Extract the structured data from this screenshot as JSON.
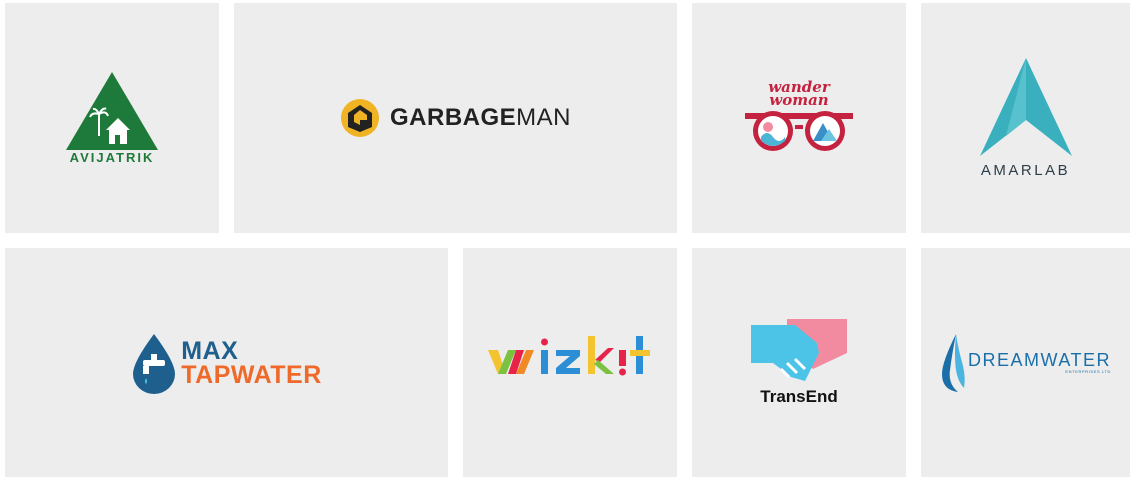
{
  "logos": [
    {
      "name": "AVIJATRIK",
      "colors": {
        "primary": "#1d7a3a"
      }
    },
    {
      "name_bold": "GARBAGE",
      "name_light": "MAN",
      "colors": {
        "badge": "#f0b323",
        "text": "#222222"
      }
    },
    {
      "line1": "wander",
      "line2": "woman",
      "colors": {
        "primary": "#c5223f"
      }
    },
    {
      "name": "AMARLAB",
      "colors": {
        "primary": "#3ab0bf",
        "text": "#2d3e4a"
      }
    },
    {
      "line1": "MAX",
      "line2": "TAPWATER",
      "colors": {
        "primary": "#1e5f8e",
        "accent": "#ef6a2a"
      }
    },
    {
      "name": "wizkit"
    },
    {
      "name": "TransEnd",
      "colors": {
        "left": "#4cc4e8",
        "right": "#f28aa0"
      }
    },
    {
      "name": "DREAMWATER",
      "subtitle": "ENTERPRISES LTD",
      "colors": {
        "primary": "#1a6fa8"
      }
    }
  ]
}
